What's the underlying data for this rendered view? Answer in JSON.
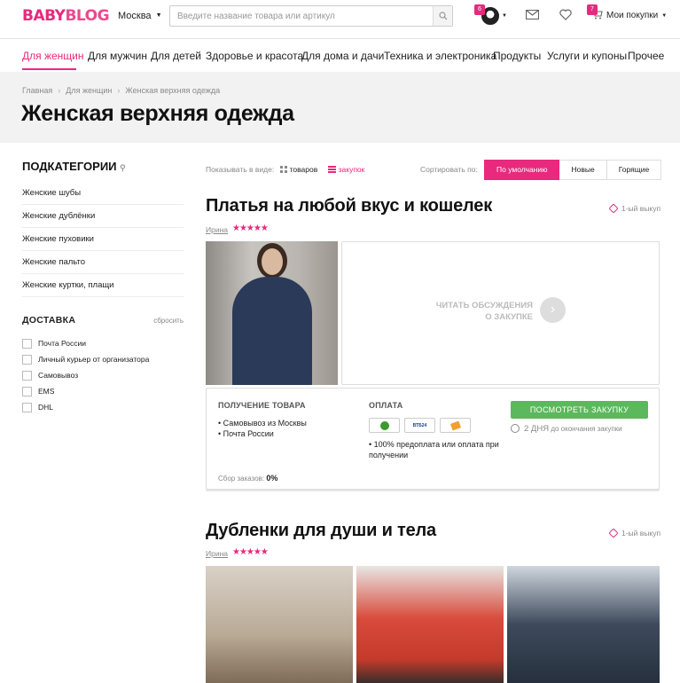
{
  "header": {
    "logo_part1": "BABY",
    "logo_part2": "BLOG",
    "city": "Москва",
    "search_placeholder": "Введите название товара или артикул",
    "avatar_badge": "6",
    "cart_badge": "7",
    "my_purchases": "Мои покупки"
  },
  "nav": {
    "items": [
      "Для женщин",
      "Для мужчин",
      "Для детей",
      "Здоровье и красота",
      "Для дома и дачи",
      "Техника и электроника",
      "Продукты",
      "Услуги и купоны",
      "Прочее"
    ]
  },
  "breadcrumbs": [
    "Главная",
    "Для женщин",
    "Женская верхняя одежда"
  ],
  "page_title": "Женская верхняя одежда",
  "sidebar": {
    "title": "ПОДКАТЕГОРИИ",
    "items": [
      "Женские шубы",
      "Женские дублёнки",
      "Женские пуховики",
      "Женские пальто",
      "Женские куртки, плащи"
    ]
  },
  "delivery": {
    "title": "ДОСТАВКА",
    "reset": "сбросить",
    "options": [
      "Почта России",
      "Личный курьер от организатора",
      "Самовывоз",
      "EMS",
      "DHL"
    ]
  },
  "toolbar": {
    "show_label": "Показывать в виде:",
    "view_products": "товаров",
    "view_purchases": "закупок",
    "sort_label": "Сортировать по:",
    "sort_options": [
      "По умолчанию",
      "Новые",
      "Горящие"
    ],
    "sort_active": "По умолчанию"
  },
  "purchases": [
    {
      "title": "Платья на любой вкус и кошелек",
      "round": "1-ый выкуп",
      "organizer": "Ирина",
      "rating": 5,
      "stars": "★★★★★",
      "discuss": "ЧИТАТЬ ОБСУЖДЕНИЯ О ЗАКУПКЕ",
      "receive_title": "ПОЛУЧЕНИЕ ТОВАРА",
      "receive_items": [
        "Самовывоз из Москвы",
        "Почта России"
      ],
      "payment_title": "ОПЛАТА",
      "payment_methods": [
        "sberbank-icon",
        "vtb24-icon",
        "card-icon"
      ],
      "vtb_label": "ВТБ24",
      "payment_note": "100% предоплата или оплата при получении",
      "view_button": "ПОСМОТРЕТЬ ЗАКУПКУ",
      "days_left": "2 ДНЯ",
      "days_suffix": "до окончания закупки",
      "collect_label": "Сбор заказов:",
      "collect_value": "0%"
    },
    {
      "title": "Дубленки для души и тела",
      "round": "1-ый выкуп",
      "organizer": "Ирина",
      "rating": 5,
      "stars": "★★★★★"
    }
  ],
  "colors": {
    "accent": "#e8297d",
    "button_green": "#5cb85c",
    "hero_bg": "#f2f2f2"
  }
}
